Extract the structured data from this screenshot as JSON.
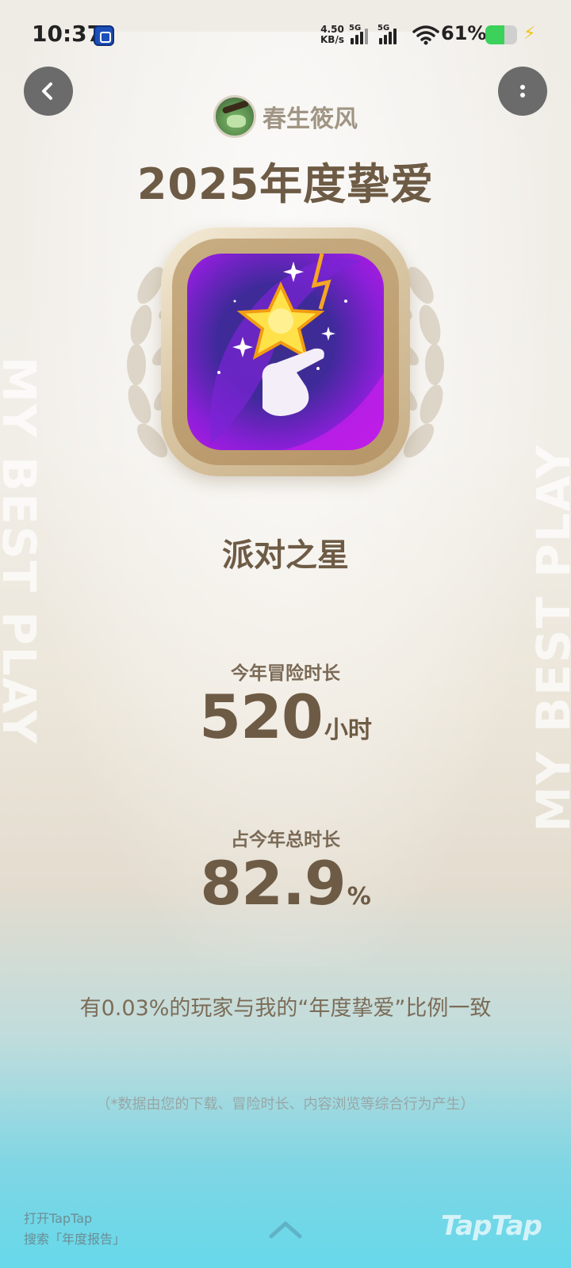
{
  "status_bar": {
    "time": "10:37",
    "speed_value": "4.50",
    "speed_unit": "KB/s",
    "sim1_label": "5G",
    "sim2_label": "5G",
    "battery_percent": "61%",
    "battery_level": 0.61,
    "charging_color": "#f1c21b"
  },
  "header": {
    "back_icon": "chevron-left-icon",
    "more_icon": "vertical-dots-icon",
    "username": "春生筱风",
    "title": "2025年度挚爱"
  },
  "game": {
    "name": "派对之星",
    "icon": "party-star-game-icon"
  },
  "stats": {
    "adventure_label": "今年冒险时长",
    "adventure_value": "520",
    "adventure_unit": "小时",
    "share_label": "占今年总时长",
    "share_value": "82.9",
    "share_unit": "%"
  },
  "compare_text": "有0.03%的玩家与我的“年度挚爱”比例一致",
  "footnote": "（*数据由您的下载、冒险时长、内容浏览等综合行为产生）",
  "footer": {
    "hint_line1": "打开TapTap",
    "hint_line2": "搜索「年度报告」",
    "logo_text": "TapTap",
    "swipe_icon": "chevron-up-icon"
  },
  "decor": {
    "side_text": "MY BEST PLAY",
    "accent_color": "#6e5b45",
    "bottom_color": "#66d8ea"
  }
}
